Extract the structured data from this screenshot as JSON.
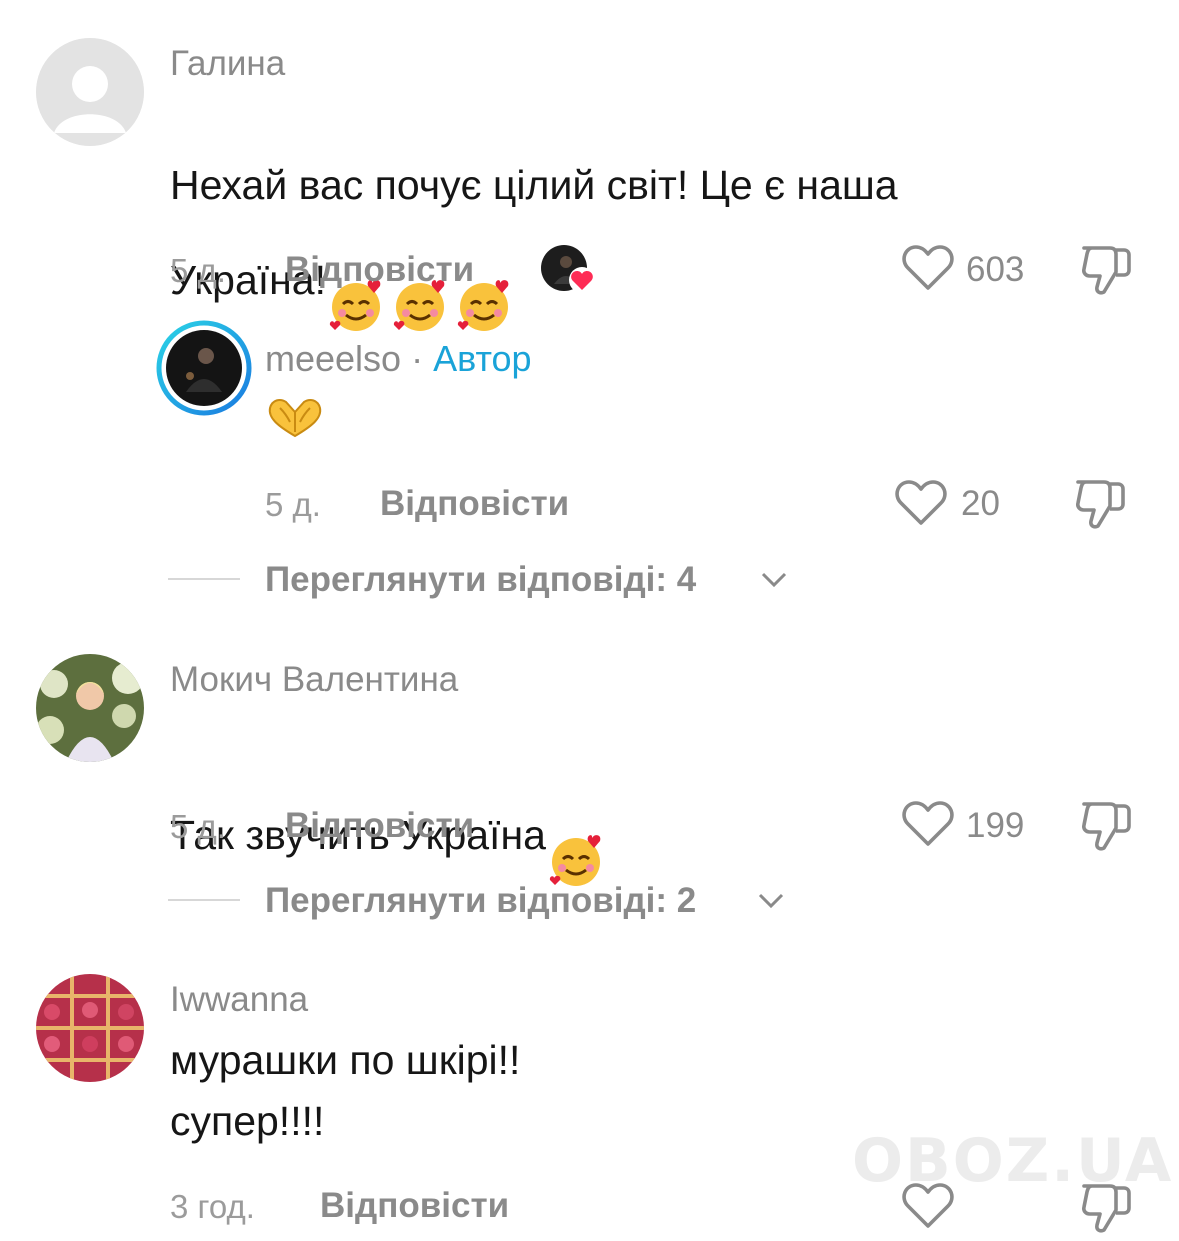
{
  "comments": [
    {
      "username": "Галина",
      "text": "Нехай вас почує цілий світ! Це є наша\nУкраїна!",
      "time": "5 д.",
      "reply": "Відповісти",
      "likes": "603",
      "avatar": "default-avatar",
      "creator_liked": true
    },
    {
      "username": "meeelso",
      "separator": "·",
      "badge": "Автор",
      "text": "🫶",
      "time": "5 д.",
      "reply": "Відповісти",
      "likes": "20",
      "avatar": "author-avatar"
    },
    {
      "username": "Мокич Валентина",
      "text": "Так звучить Україна",
      "time": "5 д.",
      "reply": "Відповісти",
      "likes": "199",
      "avatar": "photo-avatar-flowers"
    },
    {
      "username": "Iwwanna",
      "text": "мурашки по шкірі!!\nсупер!!!!",
      "time": "3 год.",
      "reply": "Відповісти",
      "likes": "",
      "avatar": "photo-avatar-raspberries"
    }
  ],
  "view_replies": [
    {
      "label": "Переглянути відповіді: 4"
    },
    {
      "label": "Переглянути відповіді: 2"
    }
  ],
  "watermark": "OBOZ.UA",
  "colors": {
    "author_badge": "#1aa3d8",
    "like_heart": "#fe2c55",
    "muted_text": "#8a8a8a"
  }
}
